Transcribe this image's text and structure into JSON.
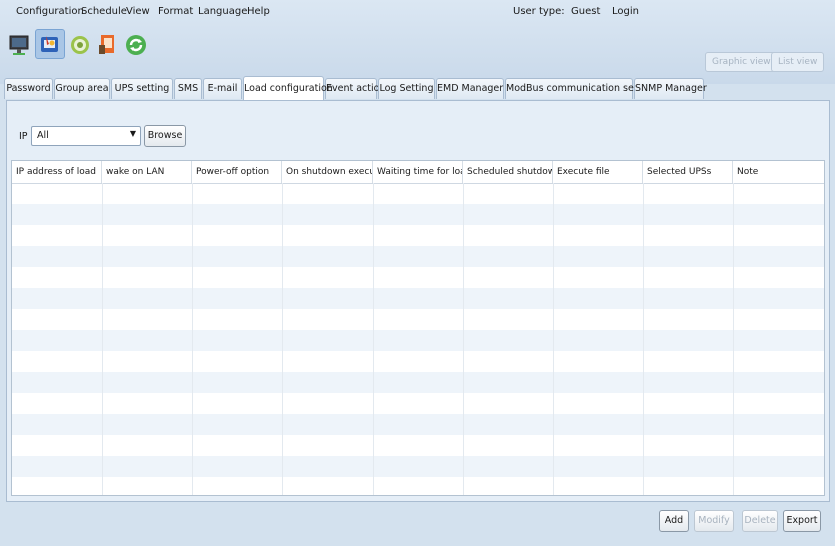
{
  "menu": [
    "Configuration",
    "Schedule",
    "View",
    "Format",
    "Language",
    "Help"
  ],
  "user": {
    "type_label": "User type:",
    "type_value": "Guest",
    "login": "Login"
  },
  "toolbar": {
    "icons": [
      "monitor-icon",
      "settings-tools-icon",
      "gear-icon",
      "report-icon",
      "refresh-icon"
    ]
  },
  "view_buttons": {
    "graphic": "Graphic view",
    "list": "List view"
  },
  "tabs": [
    "Password",
    "Group area",
    "UPS setting",
    "SMS",
    "E-mail",
    "Load configuration",
    "Event action",
    "Log Setting",
    "EMD Manager",
    "ModBus communication setting",
    "SNMP Manager"
  ],
  "active_tab": "Load configuration",
  "filter": {
    "label": "IP",
    "value": "All",
    "browse": "Browse"
  },
  "table": {
    "columns": [
      "IP address of load",
      "wake on LAN",
      "Power-off option",
      "On shutdown execute file",
      "Waiting time for load shutdown",
      "Scheduled shutdown",
      "Execute file",
      "Selected UPSs",
      "Note"
    ],
    "rows": []
  },
  "actions": {
    "add": "Add",
    "modify": "Modify",
    "delete": "Delete",
    "export": "Export"
  },
  "colors": {
    "accent": "#a9c6e6",
    "background": "#d3e1ee",
    "panel": "#e5eef7"
  }
}
